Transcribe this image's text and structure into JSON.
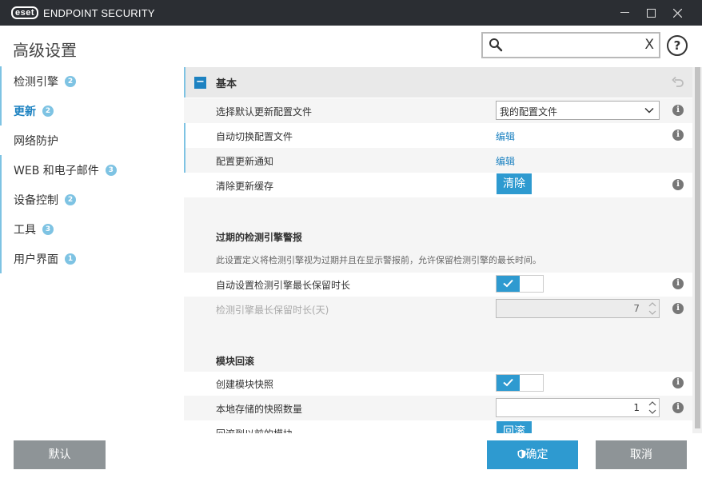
{
  "app": {
    "logo": "eset",
    "product": "ENDPOINT SECURITY"
  },
  "window": {
    "minimize_icon": "minimize-icon",
    "maximize_icon": "maximize-icon",
    "close_icon": "close-icon"
  },
  "header": {
    "title": "高级设置",
    "search": {
      "value": "",
      "placeholder": "",
      "clear_glyph": "X"
    },
    "help": "?"
  },
  "sidebar": {
    "items": [
      {
        "label": "检测引擎",
        "badge": "2",
        "active": false
      },
      {
        "label": "更新",
        "badge": "2",
        "active": true
      },
      {
        "label": "网络防护",
        "badge": "",
        "active": false
      },
      {
        "label": "WEB 和电子邮件",
        "badge": "3",
        "active": false
      },
      {
        "label": "设备控制",
        "badge": "2",
        "active": false
      },
      {
        "label": "工具",
        "badge": "3",
        "active": false
      },
      {
        "label": "用户界面",
        "badge": "1",
        "active": false
      }
    ]
  },
  "main": {
    "section": {
      "collapse_glyph": "−",
      "title": "基本"
    },
    "rows": {
      "profile": {
        "label": "选择默认更新配置文件",
        "value": "我的配置文件"
      },
      "auto_switch": {
        "label": "自动切换配置文件",
        "link": "编辑"
      },
      "notifications": {
        "label": "配置更新通知",
        "link": "编辑"
      },
      "clear_cache": {
        "label": "清除更新缓存",
        "button": "清除"
      }
    },
    "outdated": {
      "heading": "过期的检测引擎警报",
      "description": "此设置定义将检测引擎视为过期并且在显示警报前，允许保留检测引擎的最长时间。",
      "auto_max": {
        "label": "自动设置检测引擎最长保留时长",
        "enabled": true
      },
      "max_days": {
        "label": "检测引擎最长保留时长(天)",
        "value": "7"
      }
    },
    "rollback": {
      "heading": "模块回滚",
      "snapshots": {
        "label": "创建模块快照",
        "enabled": true
      },
      "count": {
        "label": "本地存储的快照数量",
        "value": "1"
      },
      "rollback_prev": {
        "label": "回滚到以前的模块",
        "button": "回滚"
      }
    },
    "info_glyph": "i"
  },
  "footer": {
    "default": "默认",
    "ok": "确定",
    "cancel": "取消"
  },
  "colors": {
    "accent": "#2e9ad0",
    "titlebar": "#2b2e33",
    "badge": "#7ec3e3"
  }
}
